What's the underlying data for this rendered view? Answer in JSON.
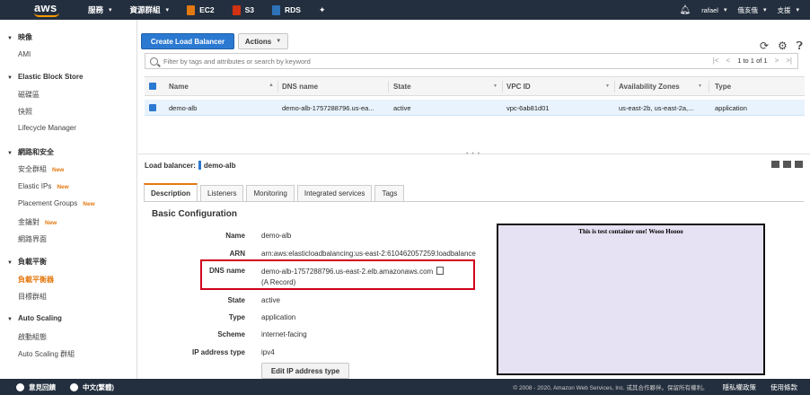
{
  "topnav": {
    "logo": "aws",
    "services": "服務",
    "resource_groups": "資源群組",
    "ec2": "EC2",
    "s3": "S3",
    "rds": "RDS",
    "user": "rafael",
    "region": "俄亥俄",
    "support": "支援"
  },
  "sidebar": {
    "sections": [
      {
        "title": "映像",
        "items": [
          "AMI"
        ]
      },
      {
        "title": "Elastic Block Store",
        "items": [
          "磁碟區",
          "快照",
          "Lifecycle Manager"
        ]
      },
      {
        "title": "網路和安全",
        "items": [
          "安全群組",
          "Elastic IPs",
          "Placement Groups",
          "金鑰對",
          "網路界面"
        ]
      },
      {
        "title": "負載平衡",
        "items": [
          "負載平衡器",
          "目標群組"
        ]
      },
      {
        "title": "Auto Scaling",
        "items": [
          "啟動組態",
          "Auto Scaling 群組"
        ]
      }
    ],
    "new_badge": "New"
  },
  "toolbar": {
    "create_label": "Create Load Balancer",
    "actions_label": "Actions"
  },
  "filter": {
    "placeholder": "Filter by tags and attributes or search by keyword",
    "count": "1 to 1 of 1"
  },
  "table": {
    "columns": [
      "Name",
      "DNS name",
      "State",
      "VPC ID",
      "Availability Zones",
      "Type"
    ],
    "rows": [
      {
        "name": "demo-alb",
        "dns": "demo-alb-1757288796.us-ea...",
        "state": "active",
        "vpc": "vpc-6ab81d01",
        "az": "us-east-2b, us-east-2a,...",
        "type": "application"
      }
    ]
  },
  "detail": {
    "label": "Load balancer:",
    "name": "demo-alb",
    "tabs": [
      "Description",
      "Listeners",
      "Monitoring",
      "Integrated services",
      "Tags"
    ],
    "section_title": "Basic Configuration",
    "fields": {
      "name_k": "Name",
      "name_v": "demo-alb",
      "arn_k": "ARN",
      "arn_v": "arn:aws:elasticloadbalancing:us-east-2:610462057259:loadbalance",
      "dns_k": "DNS name",
      "dns_v": "demo-alb-1757288796.us-east-2.elb.amazonaws.com",
      "dns_sub": "(A Record)",
      "state_k": "State",
      "state_v": "active",
      "type_k": "Type",
      "type_v": "application",
      "scheme_k": "Scheme",
      "scheme_v": "internet-facing",
      "ip_k": "IP address type",
      "ip_v": "ipv4"
    },
    "edit_ip_label": "Edit IP address type"
  },
  "test_container": {
    "text": "This is test container one! Wooo Hoooo"
  },
  "footer": {
    "feedback": "意見回饋",
    "language": "中文(繁體)",
    "copyright": "© 2008 - 2020, Amazon Web Services, Inc. 或其合作夥伴。保留所有權利。",
    "privacy": "隱私權政策",
    "terms": "使用條款"
  },
  "colors": {
    "nav_bg": "#232f3e",
    "primary": "#2b79d1",
    "accent": "#e47911",
    "highlight_box": "#d0021b",
    "container_bg": "#e6e2f3"
  }
}
